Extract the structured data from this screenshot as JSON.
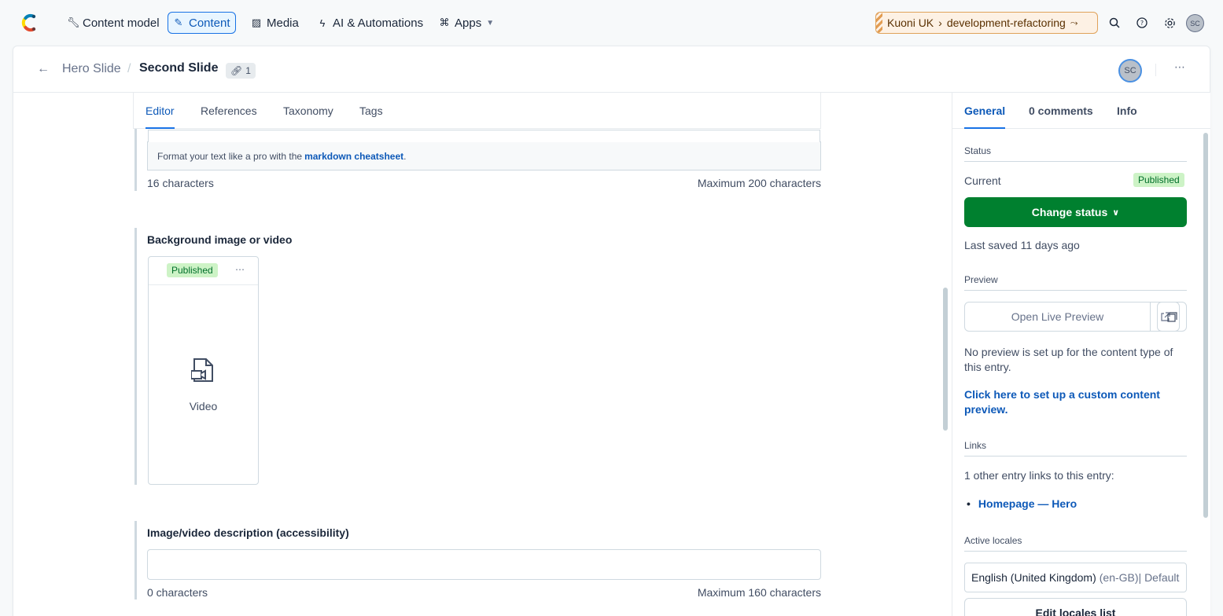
{
  "topnav": {
    "items": [
      {
        "label": "Content model",
        "icon": "wrench-icon"
      },
      {
        "label": "Content",
        "icon": "pen-icon"
      },
      {
        "label": "Media",
        "icon": "image-icon"
      },
      {
        "label": "AI & Automations",
        "icon": "bolt-icon"
      },
      {
        "label": "Apps",
        "icon": "puzzle-icon"
      }
    ],
    "space": "Kuoni UK",
    "environment": "development-refactoring",
    "avatar_initials": "SC"
  },
  "header": {
    "content_type": "Hero Slide",
    "entry_title": "Second Slide",
    "ref_count": "1",
    "avatar_initials": "SC"
  },
  "editor": {
    "tabs": [
      "Editor",
      "References",
      "Taxonomy",
      "Tags"
    ],
    "markdown_hint_prefix": "Format your text like a pro with the",
    "markdown_link": "markdown cheatsheet",
    "markdown_hint_suffix": ".",
    "field1_count": "16 characters",
    "field1_max": "Maximum 200 characters",
    "bg_label": "Background image or video",
    "asset_status": "Published",
    "asset_type": "Video",
    "desc_label": "Image/video description (accessibility)",
    "desc_value": "",
    "field3_count": "0 characters",
    "field3_max": "Maximum 160 characters"
  },
  "sidebar": {
    "tabs": [
      "General",
      "0 comments",
      "Info"
    ],
    "status_title": "Status",
    "current_label": "Current",
    "current_status": "Published",
    "change_status": "Change status",
    "last_saved": "Last saved 11 days ago",
    "preview_title": "Preview",
    "open_preview": "Open Live Preview",
    "preview_note": "No preview is set up for the content type of this entry.",
    "preview_link": "Click here to set up a custom content preview.",
    "links_title": "Links",
    "links_note": "1 other entry links to this entry:",
    "link_item": "Homepage — Hero",
    "locales_title": "Active locales",
    "locale_name": "English (United Kingdom)",
    "locale_meta": "(en-GB)| Default",
    "edit_locales": "Edit locales list"
  },
  "colors": {
    "accent": "#1872e5",
    "publish_green": "#00802f",
    "published_badge": "#cdf3c6"
  }
}
